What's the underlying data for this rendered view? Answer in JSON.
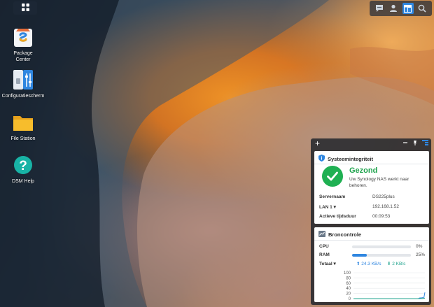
{
  "desktop": {
    "icons": [
      {
        "label": "Package\nCenter",
        "icon": "package-center-icon"
      },
      {
        "label": "Configuratiescherm",
        "icon": "control-panel-icon"
      },
      {
        "label": "File Station",
        "icon": "folder-icon"
      },
      {
        "label": "DSM Help",
        "icon": "help-icon"
      }
    ]
  },
  "taskbar": {
    "tray_icons": [
      "chat-icon",
      "user-icon",
      "widgets-icon",
      "search-icon"
    ]
  },
  "widgets": {
    "health": {
      "title": "Systeemintegriteit",
      "status": "Gezond",
      "status_color": "#1fa34d",
      "message": "Uw Synology NAS werkt naar behoren.",
      "rows": [
        {
          "label": "Servernaam",
          "value": "DS225plus"
        },
        {
          "label": "LAN 1 ▾",
          "value": "192.168.1.52"
        },
        {
          "label": "Actieve tijdsduur",
          "value": "00:09:53"
        }
      ]
    },
    "resource": {
      "title": "Broncontrole",
      "cpu": {
        "label": "CPU",
        "percent_label": "0%",
        "percent": 0
      },
      "ram": {
        "label": "RAM",
        "percent_label": "25%",
        "percent": 25
      },
      "network": {
        "label": "Totaal ▾",
        "upload": "24.3 KB/s",
        "download": "2 KB/s"
      }
    }
  },
  "chart_data": {
    "type": "line",
    "ylim": [
      0,
      100
    ],
    "yticks": [
      "100",
      "80",
      "60",
      "40",
      "20",
      "0"
    ],
    "series": [
      {
        "values": [
          0,
          0,
          0,
          0,
          0,
          0,
          0,
          0,
          0,
          0,
          0,
          0,
          0,
          0,
          0,
          0,
          0,
          0,
          0,
          0,
          0,
          0,
          0,
          0,
          0,
          0,
          0,
          0,
          0,
          0,
          0,
          0,
          0,
          0,
          0,
          0,
          0,
          0,
          0,
          0,
          0,
          0,
          0,
          0,
          0,
          0,
          0,
          0,
          0,
          0,
          0,
          0,
          0,
          0,
          0,
          0,
          0,
          0,
          0,
          0,
          0,
          0,
          0,
          0,
          0,
          0,
          0,
          0,
          0,
          0,
          2,
          3,
          2,
          4,
          3,
          5,
          24
        ]
      },
      {
        "values": [
          0,
          0,
          0,
          0,
          0,
          0,
          0,
          0,
          0,
          0,
          0,
          0,
          0,
          0,
          0,
          0,
          0,
          0,
          0,
          0,
          0,
          0,
          0,
          0,
          0,
          0,
          0,
          0,
          0,
          0,
          0,
          0,
          0,
          0,
          0,
          0,
          0,
          0,
          0,
          0,
          0,
          0,
          0,
          0,
          0,
          0,
          0,
          0,
          0,
          0,
          0,
          0,
          0,
          0,
          0,
          0,
          0,
          0,
          0,
          0,
          0,
          0,
          0,
          0,
          0,
          0,
          0,
          0,
          0,
          0,
          0,
          0,
          1,
          0,
          1,
          1,
          2
        ]
      }
    ],
    "colors": [
      "#2f86e0",
      "#1fa38d"
    ]
  },
  "colors": {
    "accent": "#2f86e0",
    "success": "#1fb052",
    "panel": "#1c222a"
  }
}
